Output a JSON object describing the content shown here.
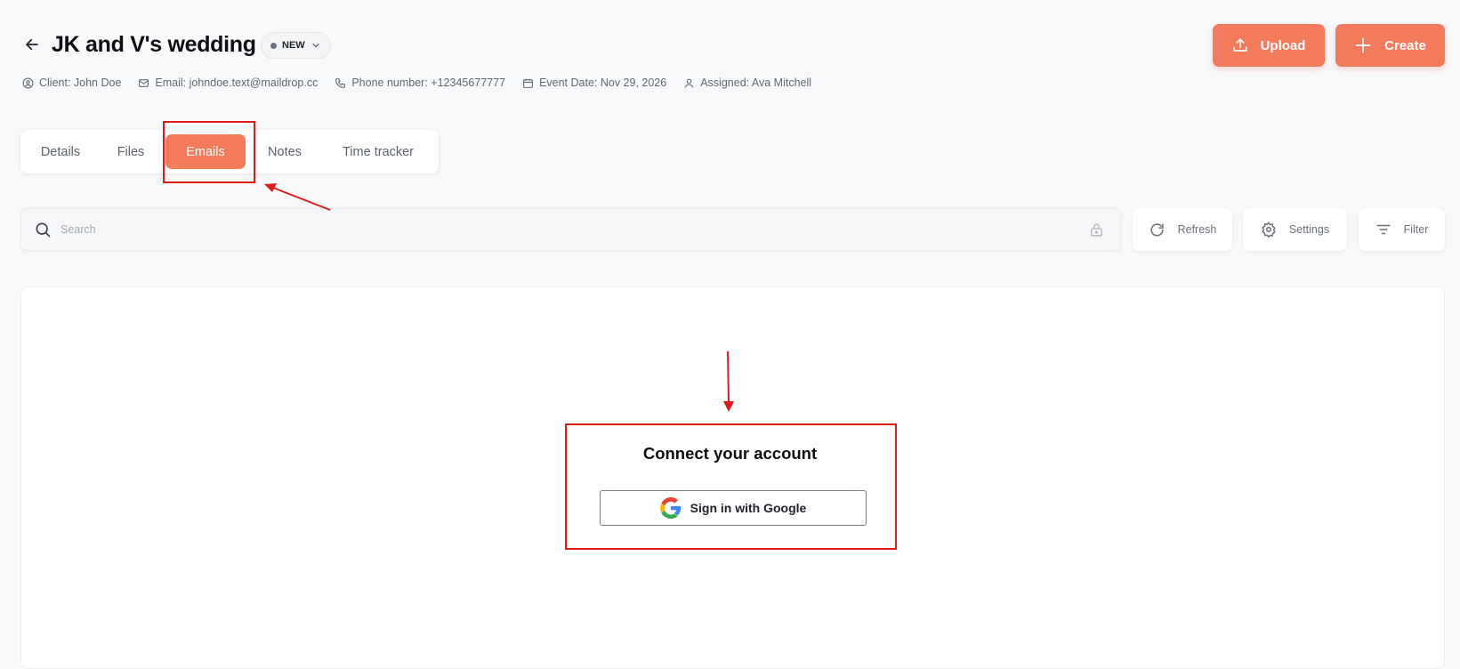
{
  "header": {
    "title": "JK and V's wedding",
    "status": "NEW",
    "meta": {
      "client": "Client: John Doe",
      "email": "Email: johndoe.text@maildrop.cc",
      "phone": "Phone number: +12345677777",
      "event_date": "Event Date: Nov 29, 2026",
      "assigned": "Assigned: Ava Mitchell"
    },
    "upload_label": "Upload",
    "create_label": "Create"
  },
  "tabs": [
    {
      "label": "Details",
      "active": false
    },
    {
      "label": "Files",
      "active": false
    },
    {
      "label": "Emails",
      "active": true
    },
    {
      "label": "Notes",
      "active": false
    },
    {
      "label": "Time tracker",
      "active": false
    }
  ],
  "toolbar": {
    "search_placeholder": "Search",
    "refresh_label": "Refresh",
    "settings_label": "Settings",
    "filter_label": "Filter"
  },
  "connect": {
    "title": "Connect your account",
    "google_button": "Sign in with Google"
  },
  "colors": {
    "accent": "#f47a5c",
    "annotation": "#e11a1a",
    "background": "#f8f9fb"
  },
  "icons": [
    "arrow-left-icon",
    "chevron-down-icon",
    "user-circle-icon",
    "mail-icon",
    "phone-icon",
    "calendar-icon",
    "user-icon",
    "upload-icon",
    "plus-icon",
    "search-icon",
    "lock-icon",
    "refresh-icon",
    "gear-icon",
    "filter-icon",
    "google-logo-icon"
  ]
}
